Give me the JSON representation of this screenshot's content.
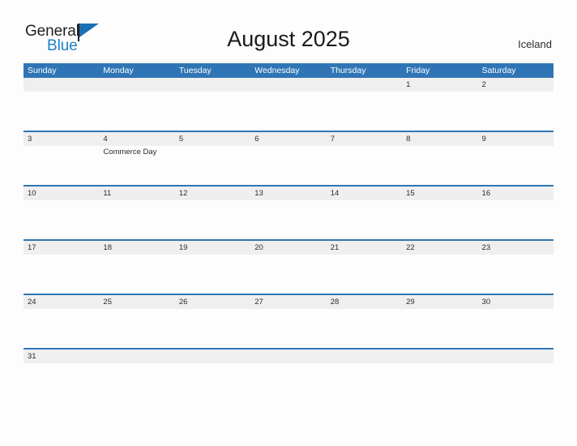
{
  "brand": {
    "name_part1": "General",
    "name_part2": "Blue",
    "flag_icon": "flag-icon"
  },
  "header": {
    "title": "August 2025",
    "country": "Iceland"
  },
  "calendar": {
    "weekday_headers": [
      "Sunday",
      "Monday",
      "Tuesday",
      "Wednesday",
      "Thursday",
      "Friday",
      "Saturday"
    ],
    "weeks": [
      {
        "days": [
          {
            "num": "",
            "events": []
          },
          {
            "num": "",
            "events": []
          },
          {
            "num": "",
            "events": []
          },
          {
            "num": "",
            "events": []
          },
          {
            "num": "",
            "events": []
          },
          {
            "num": "1",
            "events": []
          },
          {
            "num": "2",
            "events": []
          }
        ]
      },
      {
        "days": [
          {
            "num": "3",
            "events": []
          },
          {
            "num": "4",
            "events": [
              "Commerce Day"
            ]
          },
          {
            "num": "5",
            "events": []
          },
          {
            "num": "6",
            "events": []
          },
          {
            "num": "7",
            "events": []
          },
          {
            "num": "8",
            "events": []
          },
          {
            "num": "9",
            "events": []
          }
        ]
      },
      {
        "days": [
          {
            "num": "10",
            "events": []
          },
          {
            "num": "11",
            "events": []
          },
          {
            "num": "12",
            "events": []
          },
          {
            "num": "13",
            "events": []
          },
          {
            "num": "14",
            "events": []
          },
          {
            "num": "15",
            "events": []
          },
          {
            "num": "16",
            "events": []
          }
        ]
      },
      {
        "days": [
          {
            "num": "17",
            "events": []
          },
          {
            "num": "18",
            "events": []
          },
          {
            "num": "19",
            "events": []
          },
          {
            "num": "20",
            "events": []
          },
          {
            "num": "21",
            "events": []
          },
          {
            "num": "22",
            "events": []
          },
          {
            "num": "23",
            "events": []
          }
        ]
      },
      {
        "days": [
          {
            "num": "24",
            "events": []
          },
          {
            "num": "25",
            "events": []
          },
          {
            "num": "26",
            "events": []
          },
          {
            "num": "27",
            "events": []
          },
          {
            "num": "28",
            "events": []
          },
          {
            "num": "29",
            "events": []
          },
          {
            "num": "30",
            "events": []
          }
        ]
      },
      {
        "days": [
          {
            "num": "31",
            "events": []
          },
          {
            "num": "",
            "events": []
          },
          {
            "num": "",
            "events": []
          },
          {
            "num": "",
            "events": []
          },
          {
            "num": "",
            "events": []
          },
          {
            "num": "",
            "events": []
          },
          {
            "num": "",
            "events": []
          }
        ]
      }
    ]
  },
  "colors": {
    "header_blue": "#2f75b5",
    "band_gray": "#efefef",
    "brand_blue": "#1b7fc4",
    "flag_blue": "#1b6fb3",
    "page_background": "#fdfdfd",
    "text_dark": "#2b2b2b"
  }
}
